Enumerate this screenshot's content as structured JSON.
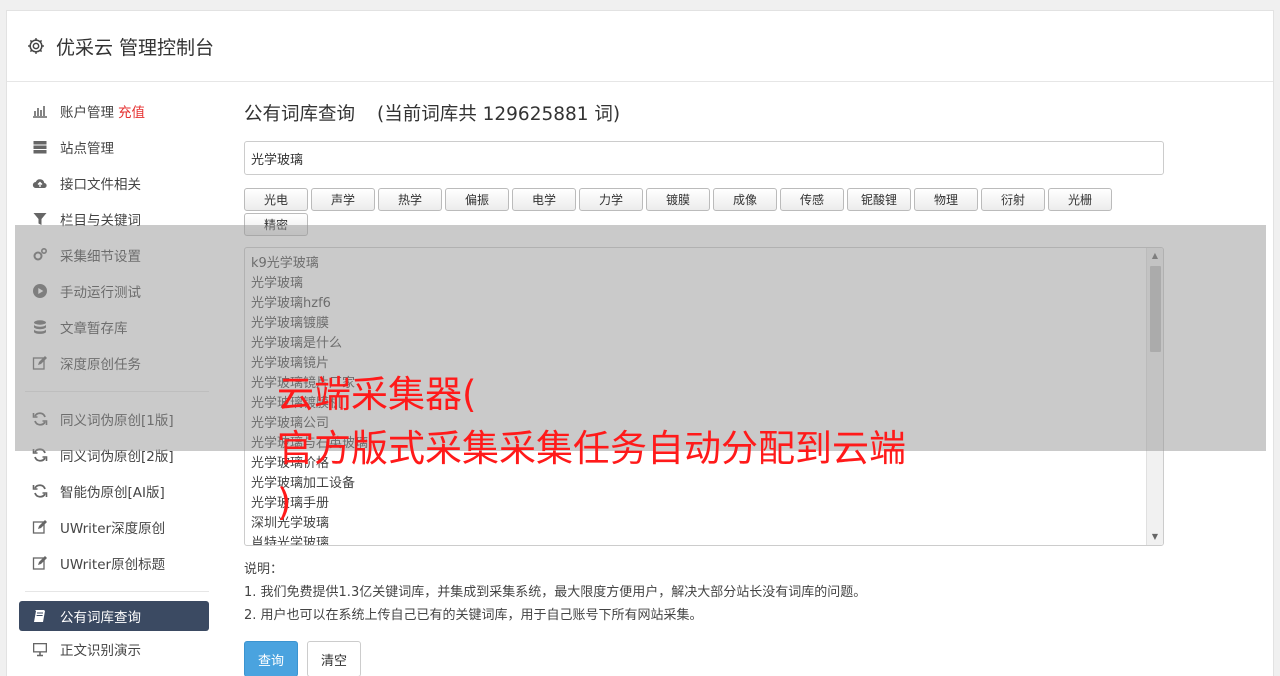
{
  "header": {
    "title": "优采云 管理控制台",
    "icon": "gear-icon"
  },
  "sidebar": {
    "group1": [
      {
        "label": "账户管理",
        "badge": "充值",
        "icon": "bar-chart-icon"
      },
      {
        "label": "站点管理",
        "icon": "server-icon"
      },
      {
        "label": "接口文件相关",
        "icon": "cloud-upload-icon"
      },
      {
        "label": "栏目与关键词",
        "icon": "filter-icon"
      },
      {
        "label": "采集细节设置",
        "icon": "cogs-icon"
      },
      {
        "label": "手动运行测试",
        "icon": "play-circle-icon"
      },
      {
        "label": "文章暂存库",
        "icon": "database-icon"
      },
      {
        "label": "深度原创任务",
        "icon": "edit-icon"
      }
    ],
    "group2": [
      {
        "label": "同义词伪原创[1版]",
        "icon": "refresh-icon"
      },
      {
        "label": "同义词伪原创[2版]",
        "icon": "refresh-icon"
      },
      {
        "label": "智能伪原创[AI版]",
        "icon": "refresh-icon"
      },
      {
        "label": "UWriter深度原创",
        "icon": "edit-icon"
      },
      {
        "label": "UWriter原创标题",
        "icon": "edit-icon"
      }
    ],
    "group3": [
      {
        "label": "公有词库查询",
        "icon": "book-icon",
        "active": true
      },
      {
        "label": "正文识别演示",
        "icon": "monitor-icon"
      }
    ]
  },
  "main": {
    "title": "公有词库查询",
    "count_text": "(当前词库共 129625881 词)",
    "search_value": "光学玻璃",
    "tags": [
      "光电",
      "声学",
      "热学",
      "偏振",
      "电学",
      "力学",
      "镀膜",
      "成像",
      "传感",
      "铌酸锂",
      "物理",
      "衍射",
      "光栅",
      "精密"
    ],
    "results": [
      "k9光学玻璃",
      "光学玻璃",
      "光学玻璃hzf6",
      "光学玻璃镀膜",
      "光学玻璃是什么",
      "光学玻璃镜片",
      "光学玻璃镜片厂家",
      "光学玻璃镀膜机",
      "光学玻璃公司",
      "光学玻璃与石英玻璃",
      "光学玻璃价格",
      "光学玻璃加工设备",
      "光学玻璃手册",
      "深圳光学玻璃",
      "肖特光学玻璃"
    ],
    "notes_title": "说明：",
    "notes": [
      "1. 我们免费提供1.3亿关键词库，并集成到采集系统，最大限度方便用户，解决大部分站长没有词库的问题。",
      "2. 用户也可以在系统上传自己已有的关键词库，用于自己账号下所有网站采集。"
    ],
    "query_button": "查询",
    "clear_button": "清空"
  },
  "watermark": {
    "line1": "云端采集器(",
    "line2": "官方版式采集采集任务自动分配到云端",
    "line3": ")"
  },
  "colors": {
    "active_nav": "#3b4a62",
    "primary": "#4aa3df",
    "badge": "#e53030",
    "watermark": "#ff1a1a"
  }
}
